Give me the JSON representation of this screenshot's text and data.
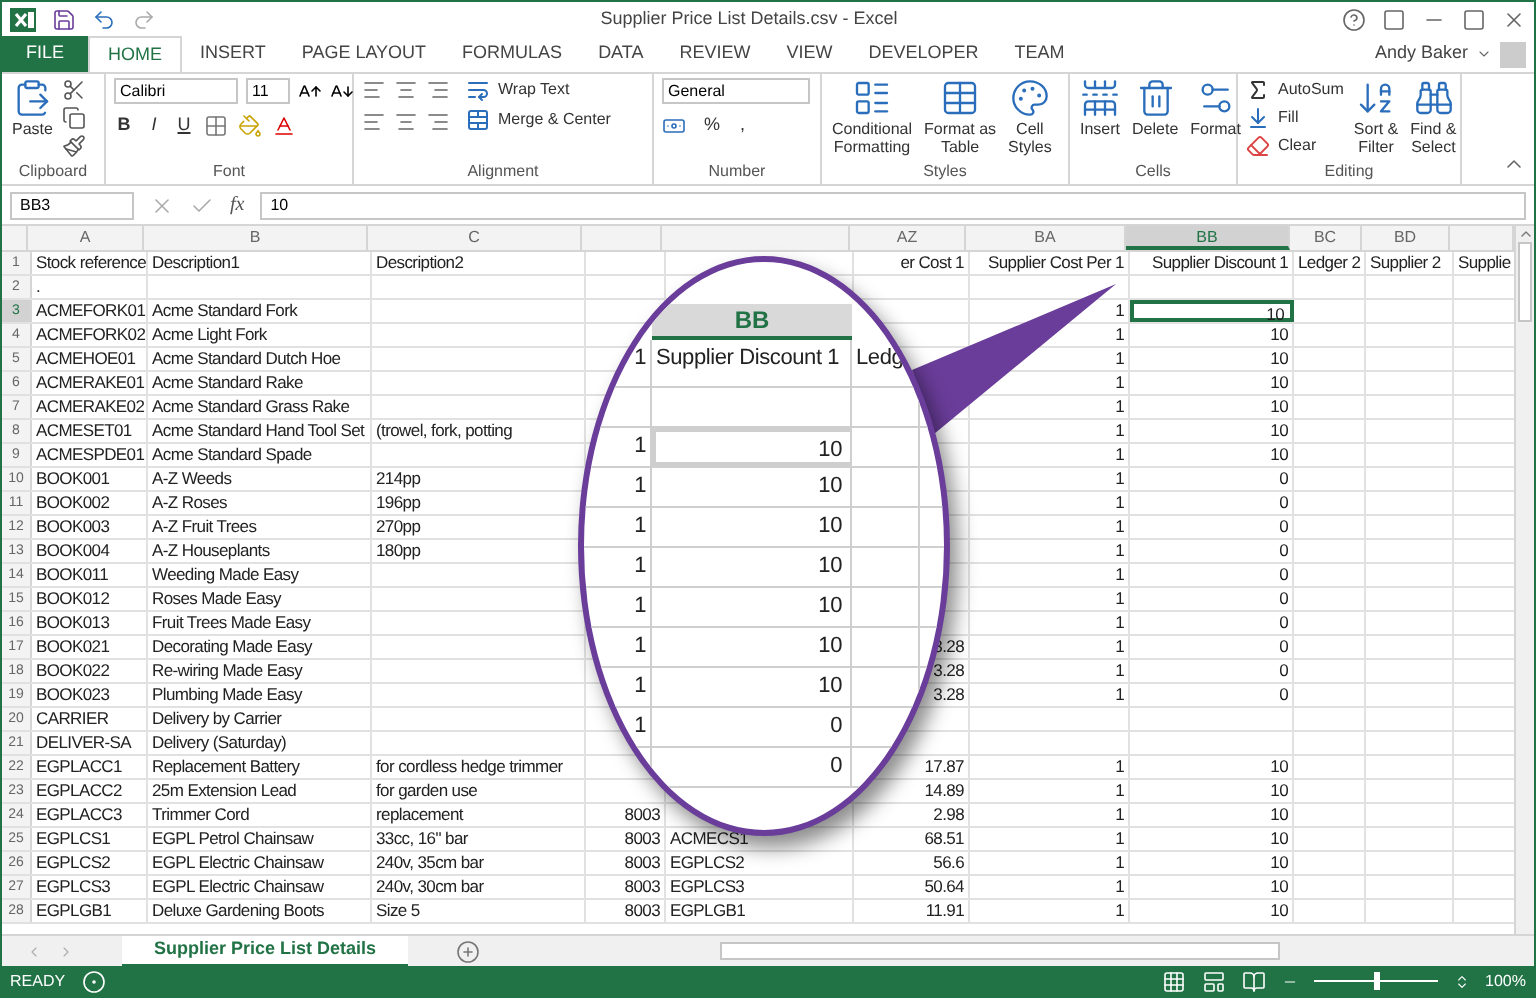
{
  "window": {
    "title": "Supplier Price List Details.csv - Excel",
    "user": "Andy Baker"
  },
  "ribbon_tabs": [
    {
      "label": "FILE",
      "kind": "file",
      "selected": false
    },
    {
      "label": "HOME",
      "kind": "tab",
      "selected": true
    },
    {
      "label": "INSERT",
      "kind": "tab",
      "selected": false
    },
    {
      "label": "PAGE LAYOUT",
      "kind": "tab",
      "selected": false
    },
    {
      "label": "FORMULAS",
      "kind": "tab",
      "selected": false
    },
    {
      "label": "DATA",
      "kind": "tab",
      "selected": false
    },
    {
      "label": "REVIEW",
      "kind": "tab",
      "selected": false
    },
    {
      "label": "VIEW",
      "kind": "tab",
      "selected": false
    },
    {
      "label": "DEVELOPER",
      "kind": "tab",
      "selected": false
    },
    {
      "label": "TEAM",
      "kind": "tab",
      "selected": false
    }
  ],
  "ribbon": {
    "clipboard": {
      "label": "Clipboard",
      "paste": "Paste"
    },
    "font": {
      "label": "Font",
      "font_name": "Calibri",
      "font_size": "11",
      "styles": [
        "B",
        "I",
        "U"
      ]
    },
    "alignment": {
      "label": "Alignment",
      "wrap_text": "Wrap Text",
      "merge": "Merge & Center"
    },
    "number": {
      "label": "Number",
      "format": "General",
      "symbols": [
        "%",
        ","
      ]
    },
    "styles": {
      "label": "Styles",
      "buttons": [
        [
          "Conditional",
          "Formatting"
        ],
        [
          "Format as",
          "Table"
        ],
        [
          "Cell",
          "Styles"
        ]
      ]
    },
    "cells": {
      "label": "Cells",
      "buttons": [
        "Insert",
        "Delete",
        "Format"
      ]
    },
    "editing": {
      "label": "Editing",
      "autosum": "AutoSum",
      "fill": "Fill",
      "clear": "Clear",
      "buttons": [
        [
          "Sort &",
          "Filter"
        ],
        [
          "Find &",
          "Select"
        ]
      ]
    }
  },
  "formula_bar": {
    "name_box": "BB3",
    "fx": "fx",
    "value": "10"
  },
  "sheet": {
    "columns": [
      {
        "label": "A",
        "selected": false
      },
      {
        "label": "B",
        "selected": false
      },
      {
        "label": "C",
        "selected": false
      },
      {
        "selected": false
      },
      {
        "selected": false
      },
      {
        "label": "AZ",
        "selected": false
      },
      {
        "label": "BA",
        "selected": false
      },
      {
        "label": "BB",
        "selected": true
      },
      {
        "label": "BC",
        "selected": false
      },
      {
        "label": "BD",
        "selected": false
      },
      {
        "selected": false
      }
    ],
    "rows": [
      {
        "number": "1",
        "selected": false,
        "cells": [
          "Stock reference",
          "Description1",
          "Description2",
          null,
          null,
          "er Cost 1",
          "Supplier Cost Per 1",
          "Supplier Discount 1",
          "Ledger 2",
          "Supplier 2",
          "Supplie"
        ]
      },
      {
        "number": "2",
        "selected": false,
        "cells": [
          ".",
          null,
          null,
          null,
          null,
          null,
          null,
          null,
          null,
          null,
          null
        ]
      },
      {
        "number": "3",
        "selected": true,
        "cells": [
          "ACMEFORK01",
          "Acme Standard Fork",
          null,
          null,
          null,
          null,
          "1",
          "10",
          null,
          null,
          null
        ]
      },
      {
        "number": "4",
        "selected": false,
        "cells": [
          "ACMEFORK02",
          "Acme Light Fork",
          null,
          null,
          null,
          null,
          "1",
          "10",
          null,
          null,
          null
        ]
      },
      {
        "number": "5",
        "selected": false,
        "cells": [
          "ACMEHOE01",
          "Acme Standard Dutch Hoe",
          null,
          null,
          null,
          null,
          "1",
          "10",
          null,
          null,
          null
        ]
      },
      {
        "number": "6",
        "selected": false,
        "cells": [
          "ACMERAKE01",
          "Acme Standard Rake",
          null,
          null,
          null,
          null,
          "1",
          "10",
          null,
          null,
          null
        ]
      },
      {
        "number": "7",
        "selected": false,
        "cells": [
          "ACMERAKE02",
          "Acme Standard Grass Rake",
          null,
          null,
          null,
          null,
          "1",
          "10",
          null,
          null,
          null
        ]
      },
      {
        "number": "8",
        "selected": false,
        "cells": [
          "ACMESET01",
          "Acme Standard Hand Tool Set",
          "(trowel, fork, potting",
          null,
          null,
          null,
          "1",
          "10",
          null,
          null,
          null
        ]
      },
      {
        "number": "9",
        "selected": false,
        "cells": [
          "ACMESPDE01",
          "Acme Standard Spade",
          null,
          null,
          null,
          null,
          "1",
          "10",
          null,
          null,
          null
        ]
      },
      {
        "number": "10",
        "selected": false,
        "cells": [
          "BOOK001",
          "A-Z Weeds",
          "214pp",
          null,
          null,
          null,
          "1",
          "0",
          null,
          null,
          null
        ]
      },
      {
        "number": "11",
        "selected": false,
        "cells": [
          "BOOK002",
          "A-Z Roses",
          "196pp",
          null,
          null,
          null,
          "1",
          "0",
          null,
          null,
          null
        ]
      },
      {
        "number": "12",
        "selected": false,
        "cells": [
          "BOOK003",
          "A-Z Fruit Trees",
          "270pp",
          null,
          null,
          null,
          "1",
          "0",
          null,
          null,
          null
        ]
      },
      {
        "number": "13",
        "selected": false,
        "cells": [
          "BOOK004",
          "A-Z Houseplants",
          "180pp",
          null,
          null,
          null,
          "1",
          "0",
          null,
          null,
          null
        ]
      },
      {
        "number": "14",
        "selected": false,
        "cells": [
          "BOOK011",
          "Weeding Made Easy",
          null,
          null,
          null,
          null,
          "1",
          "0",
          null,
          null,
          null
        ]
      },
      {
        "number": "15",
        "selected": false,
        "cells": [
          "BOOK012",
          "Roses Made Easy",
          null,
          null,
          null,
          null,
          "1",
          "0",
          null,
          null,
          null
        ]
      },
      {
        "number": "16",
        "selected": false,
        "cells": [
          "BOOK013",
          "Fruit Trees Made Easy",
          null,
          null,
          null,
          null,
          "1",
          "0",
          null,
          null,
          null
        ]
      },
      {
        "number": "17",
        "selected": false,
        "cells": [
          "BOOK021",
          "Decorating Made Easy",
          null,
          null,
          null,
          "3.28",
          "1",
          "0",
          null,
          null,
          null
        ]
      },
      {
        "number": "18",
        "selected": false,
        "cells": [
          "BOOK022",
          "Re-wiring Made Easy",
          null,
          null,
          null,
          "3.28",
          "1",
          "0",
          null,
          null,
          null
        ]
      },
      {
        "number": "19",
        "selected": false,
        "cells": [
          "BOOK023",
          "Plumbing Made Easy",
          null,
          null,
          null,
          "3.28",
          "1",
          "0",
          null,
          null,
          null
        ]
      },
      {
        "number": "20",
        "selected": false,
        "cells": [
          "CARRIER",
          "Delivery by Carrier",
          null,
          null,
          null,
          null,
          null,
          null,
          null,
          null,
          null
        ]
      },
      {
        "number": "21",
        "selected": false,
        "cells": [
          "DELIVER-SA",
          "Delivery (Saturday)",
          null,
          null,
          null,
          null,
          null,
          null,
          null,
          null,
          null
        ]
      },
      {
        "number": "22",
        "selected": false,
        "cells": [
          "EGPLACC1",
          "Replacement Battery",
          "for cordless hedge trimmer",
          null,
          null,
          "17.87",
          "1",
          "10",
          null,
          null,
          null
        ]
      },
      {
        "number": "23",
        "selected": false,
        "cells": [
          "EGPLACC2",
          "25m Extension Lead",
          "for garden use",
          null,
          null,
          "14.89",
          "1",
          "10",
          null,
          null,
          null
        ]
      },
      {
        "number": "24",
        "selected": false,
        "cells": [
          "EGPLACC3",
          "Trimmer Cord",
          "replacement",
          "8003",
          null,
          "2.98",
          "1",
          "10",
          null,
          null,
          null
        ]
      },
      {
        "number": "25",
        "selected": false,
        "cells": [
          "EGPLCS1",
          "EGPL Petrol Chainsaw",
          "33cc, 16\" bar",
          "8003",
          "ACMECS1",
          "68.51",
          "1",
          "10",
          null,
          null,
          null
        ]
      },
      {
        "number": "26",
        "selected": false,
        "cells": [
          "EGPLCS2",
          "EGPL Electric Chainsaw",
          "240v, 35cm bar",
          "8003",
          "EGPLCS2",
          "56.6",
          "1",
          "10",
          null,
          null,
          null
        ]
      },
      {
        "number": "27",
        "selected": false,
        "cells": [
          "EGPLCS3",
          "EGPL Electric Chainsaw",
          "240v, 30cm bar",
          "8003",
          "EGPLCS3",
          "50.64",
          "1",
          "10",
          null,
          null,
          null
        ]
      },
      {
        "number": "28",
        "selected": false,
        "cells": [
          "EGPLGB1",
          "Deluxe Gardening Boots",
          "Size 5",
          "8003",
          "EGPLGB1",
          "11.91",
          "1",
          "10",
          null,
          null,
          null
        ]
      }
    ]
  },
  "magnifier": {
    "header": "BB",
    "rows": [
      {
        "selected": false,
        "cells": [
          "1",
          "Supplier Discount 1",
          "Ledg"
        ]
      },
      {
        "selected": false
      },
      {
        "selected": true,
        "cells": [
          "1",
          "10",
          null
        ]
      },
      {
        "selected": false,
        "cells": [
          "1",
          "10",
          null
        ]
      },
      {
        "selected": false,
        "cells": [
          "1",
          "10",
          null
        ]
      },
      {
        "selected": false,
        "cells": [
          "1",
          "10",
          null
        ]
      },
      {
        "selected": false,
        "cells": [
          "1",
          "10",
          null
        ]
      },
      {
        "selected": false,
        "cells": [
          "1",
          "10",
          null
        ]
      },
      {
        "selected": false,
        "cells": [
          "1",
          "10",
          null
        ]
      },
      {
        "selected": false,
        "cells": [
          "1",
          "0",
          null
        ]
      },
      {
        "selected": false,
        "cells": [
          null,
          "0",
          null
        ]
      }
    ]
  },
  "sheet_tabs": [
    {
      "label": "Supplier Price List Details",
      "selected": true
    }
  ],
  "status_bar": {
    "status": "READY",
    "zoom": {
      "level": 0.5
    },
    "zoom_label": "100%"
  }
}
